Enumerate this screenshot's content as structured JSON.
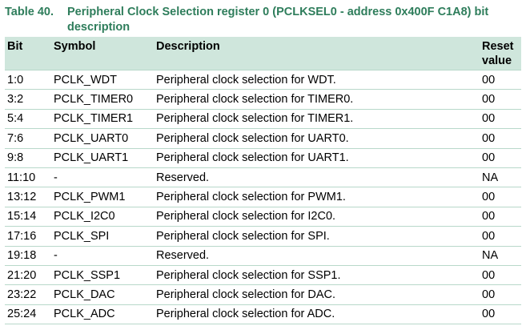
{
  "caption": {
    "number": "Table 40.",
    "title": "Peripheral Clock Selection register 0 (PCLKSEL0 - address 0x400F C1A8) bit description"
  },
  "table": {
    "headers": {
      "bit": "Bit",
      "symbol": "Symbol",
      "description": "Description",
      "reset_value": "Reset value"
    },
    "rows": [
      {
        "bit": "1:0",
        "symbol": "PCLK_WDT",
        "description": "Peripheral clock selection for WDT.",
        "reset": "00"
      },
      {
        "bit": "3:2",
        "symbol": "PCLK_TIMER0",
        "description": "Peripheral clock selection for TIMER0.",
        "reset": "00"
      },
      {
        "bit": "5:4",
        "symbol": "PCLK_TIMER1",
        "description": "Peripheral clock selection for TIMER1.",
        "reset": "00"
      },
      {
        "bit": "7:6",
        "symbol": "PCLK_UART0",
        "description": "Peripheral clock selection for UART0.",
        "reset": "00"
      },
      {
        "bit": "9:8",
        "symbol": "PCLK_UART1",
        "description": "Peripheral clock selection for UART1.",
        "reset": "00"
      },
      {
        "bit": "11:10",
        "symbol": "-",
        "description": "Reserved.",
        "reset": "NA"
      },
      {
        "bit": "13:12",
        "symbol": "PCLK_PWM1",
        "description": "Peripheral clock selection for PWM1.",
        "reset": "00"
      },
      {
        "bit": "15:14",
        "symbol": "PCLK_I2C0",
        "description": "Peripheral clock selection for I2C0.",
        "reset": "00"
      },
      {
        "bit": "17:16",
        "symbol": "PCLK_SPI",
        "description": "Peripheral clock selection for SPI.",
        "reset": "00"
      },
      {
        "bit": "19:18",
        "symbol": "-",
        "description": "Reserved.",
        "reset": "NA"
      },
      {
        "bit": "21:20",
        "symbol": "PCLK_SSP1",
        "description": "Peripheral clock selection for SSP1.",
        "reset": "00"
      },
      {
        "bit": "23:22",
        "symbol": "PCLK_DAC",
        "description": "Peripheral clock selection for DAC.",
        "reset": "00"
      },
      {
        "bit": "25:24",
        "symbol": "PCLK_ADC",
        "description": "Peripheral clock selection for ADC.",
        "reset": "00"
      }
    ]
  },
  "colors": {
    "caption_text": "#2e7d5b",
    "header_background": "#cfe6dc",
    "row_divider": "#b8d8ca"
  }
}
